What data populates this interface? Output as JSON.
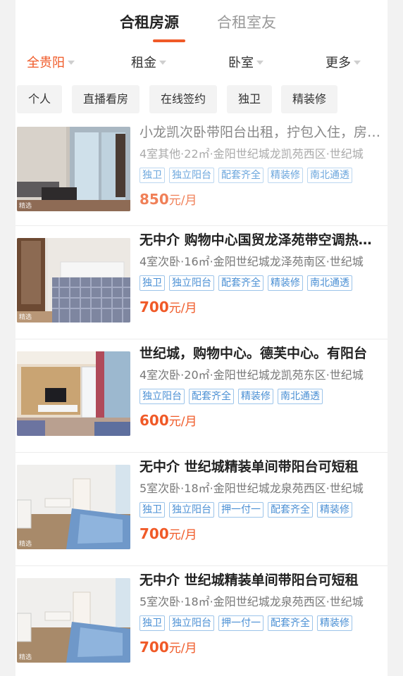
{
  "tabs": [
    {
      "label": "合租房源",
      "active": true
    },
    {
      "label": "合租室友",
      "active": false
    }
  ],
  "filters": [
    "全贵阳",
    "租金",
    "卧室",
    "更多"
  ],
  "chips": [
    "个人",
    "直播看房",
    "在线签约",
    "独卫",
    "精装修"
  ],
  "colors": {
    "accent": "#f05a28",
    "tag_blue": "#4a8fd4"
  },
  "listings": [
    {
      "title": "小龙凯次卧带阳台出租，拧包入住，房东直租",
      "subtitle": "4室其他·22㎡·金阳世纪城龙凯苑西区·世纪城",
      "tags": [
        "独卫",
        "独立阳台",
        "配套齐全",
        "精装修",
        "南北通透"
      ],
      "price": "850",
      "unit": "元/月",
      "thumb_label": "精选"
    },
    {
      "title": "无中介  购物中心国贸龙泽苑带空调热水器",
      "subtitle": "4室次卧·16㎡·金阳世纪城龙泽苑南区·世纪城",
      "tags": [
        "独卫",
        "独立阳台",
        "配套齐全",
        "精装修",
        "南北通透"
      ],
      "price": "700",
      "unit": "元/月",
      "thumb_label": "精选"
    },
    {
      "title": "世纪城，购物中心。德芙中心。有阳台",
      "subtitle": "4室次卧·20㎡·金阳世纪城龙凯苑东区·世纪城",
      "tags": [
        "独立阳台",
        "配套齐全",
        "精装修",
        "南北通透"
      ],
      "price": "600",
      "unit": "元/月",
      "thumb_label": ""
    },
    {
      "title": "无中介 世纪城精装单间带阳台可短租",
      "subtitle": "5室次卧·18㎡·金阳世纪城龙泉苑西区·世纪城",
      "tags": [
        "独卫",
        "独立阳台",
        "押一付一",
        "配套齐全",
        "精装修"
      ],
      "price": "700",
      "unit": "元/月",
      "thumb_label": "精选"
    },
    {
      "title": "无中介 世纪城精装单间带阳台可短租",
      "subtitle": "5室次卧·18㎡·金阳世纪城龙泉苑西区·世纪城",
      "tags": [
        "独卫",
        "独立阳台",
        "押一付一",
        "配套齐全",
        "精装修"
      ],
      "price": "700",
      "unit": "元/月",
      "thumb_label": "精选"
    }
  ]
}
